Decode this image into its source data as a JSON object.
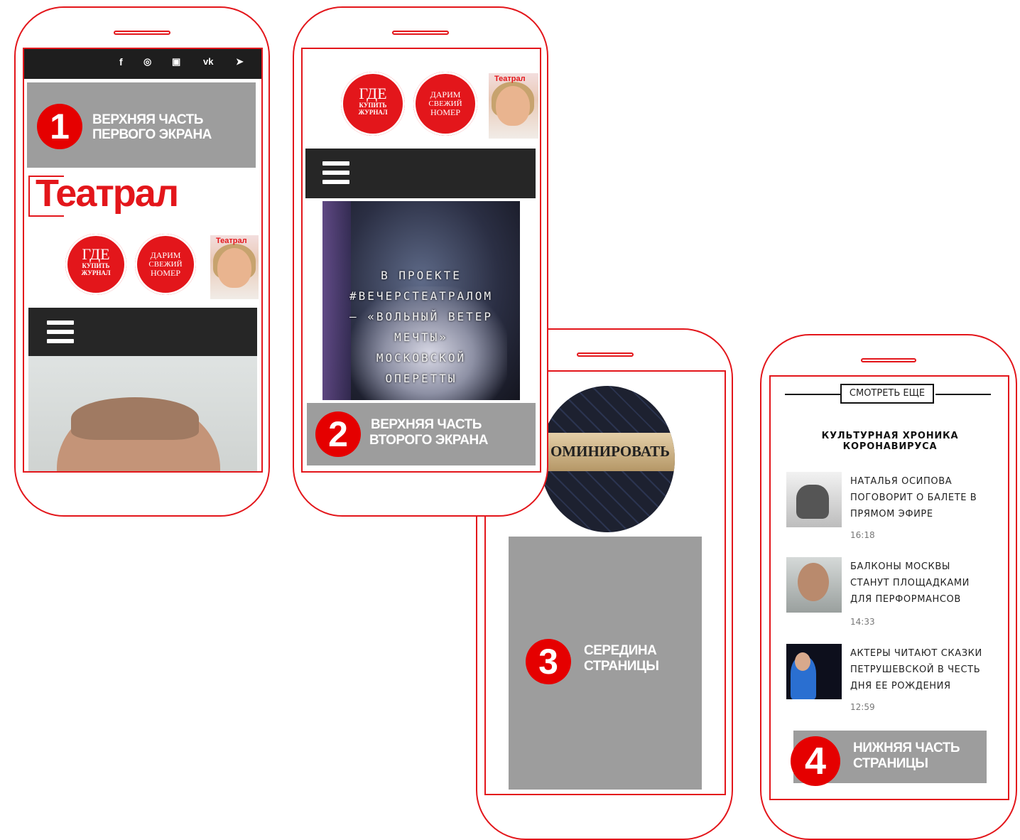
{
  "screens": [
    {
      "number": "1",
      "label_line1": "ВЕРХНЯЯ ЧАСТЬ",
      "label_line2": "ПЕРВОГО ЭКРАНА"
    },
    {
      "number": "2",
      "label_line1": "ВЕРХНЯЯ ЧАСТЬ",
      "label_line2": "ВТОРОГО ЭКРАНА"
    },
    {
      "number": "3",
      "label_line1": "СЕРЕДИНА",
      "label_line2": "СТРАНИЦЫ"
    },
    {
      "number": "4",
      "label_line1": "НИЖНЯЯ ЧАСТЬ",
      "label_line2": "СТРАНИЦЫ"
    }
  ],
  "social_icons": [
    "facebook-icon",
    "instagram-icon",
    "youtube-icon",
    "vk-icon",
    "telegram-icon"
  ],
  "social_glyphs": [
    "f",
    "◎",
    "▣",
    "vk",
    "➤"
  ],
  "logo": "Театрал",
  "promo_where": {
    "big": "ГДЕ",
    "line2": "КУПИТЬ",
    "line3": "ЖУРНАЛ"
  },
  "promo_gift": {
    "line1": "ДАРИМ",
    "line2": "СВЕЖИЙ",
    "line3": "НОМЕР"
  },
  "magazine_cover_title": "Театрал",
  "banner": {
    "lines": [
      "В ПРОЕКТЕ",
      "#ВЕЧЕРСТЕАТРАЛОМ",
      "– «ВОЛЬНЫЙ ВЕТЕР",
      "МЕЧТЫ»",
      "МОСКОВСКОЙ",
      "ОПЕРЕТТЫ"
    ]
  },
  "nominate_text": "ОМИНИРОВАТЬ",
  "see_more": "СМОТРЕТЬ ЕЩЕ",
  "section_title_line1": "КУЛЬТУРНАЯ ХРОНИКА",
  "section_title_line2": "КОРОНАВИРУСА",
  "news": [
    {
      "title": "НАТАЛЬЯ ОСИПОВА ПОГОВОРИТ О БАЛЕТЕ В ПРЯМОМ ЭФИРЕ",
      "time": "16:18"
    },
    {
      "title": "БАЛКОНЫ МОСКВЫ СТАНУТ ПЛОЩАДКАМИ ДЛЯ ПЕРФОРМАНСОВ",
      "time": "14:33"
    },
    {
      "title": "АКТЕРЫ ЧИТАЮТ СКАЗКИ ПЕТРУШЕВСКОЙ В ЧЕСТЬ ДНЯ ЕЕ РОЖДЕНИЯ",
      "time": "12:59"
    }
  ],
  "colors": {
    "accent": "#e3161b",
    "label_grey": "#9d9d9d",
    "dark_bar": "#262626",
    "number_red": "#e50000"
  }
}
